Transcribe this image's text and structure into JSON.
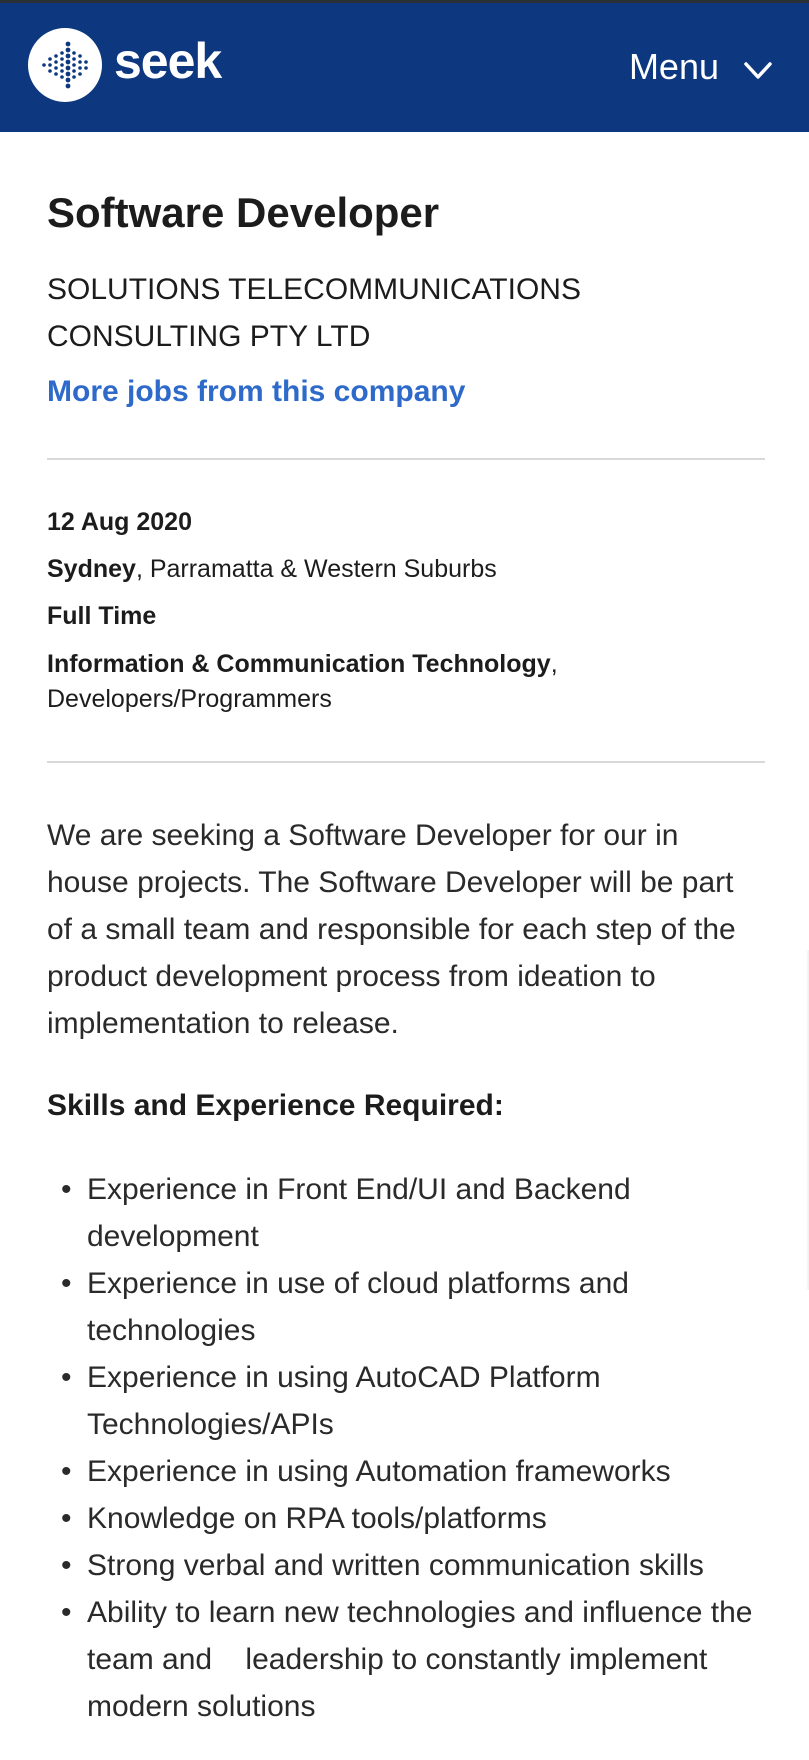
{
  "header": {
    "logo_text": "seek",
    "menu_label": "Menu",
    "bg_color": "#0d3880"
  },
  "job": {
    "title": "Software Developer",
    "company": "SOLUTIONS TELECOMMUNICATIONS CONSULTING PTY LTD",
    "more_jobs_link": "More jobs from this company",
    "date": "12 Aug 2020",
    "location_city": "Sydney",
    "location_area": ", Parramatta & Western Suburbs",
    "work_type": "Full Time",
    "classification": "Information & Communication Technology",
    "sub_classification": ", Developers/Programmers"
  },
  "description": {
    "intro": "We are seeking a Software Developer for our in house projects. The Software Developer will be part of a small team and responsible for each step of the product development process from ideation to implementation to release.",
    "skills_heading": "Skills and Experience Required:",
    "skills": [
      "Experience in Front End/UI and Backend development",
      "Experience in use of cloud platforms and technologies",
      "Experience in using AutoCAD Platform Technologies/APIs",
      "Experience in using Automation frameworks",
      "Knowledge on RPA tools/platforms",
      "Strong verbal and written communication skills",
      "Ability to learn new technologies and influence the team and    leadership to constantly implement modern solutions"
    ]
  },
  "icons": {
    "logo": "seek-dots-logo-icon",
    "menu": "chevron-down-icon"
  },
  "colors": {
    "link": "#2e6ac9",
    "text": "#1c1c1c",
    "divider": "#d9d9d9"
  }
}
